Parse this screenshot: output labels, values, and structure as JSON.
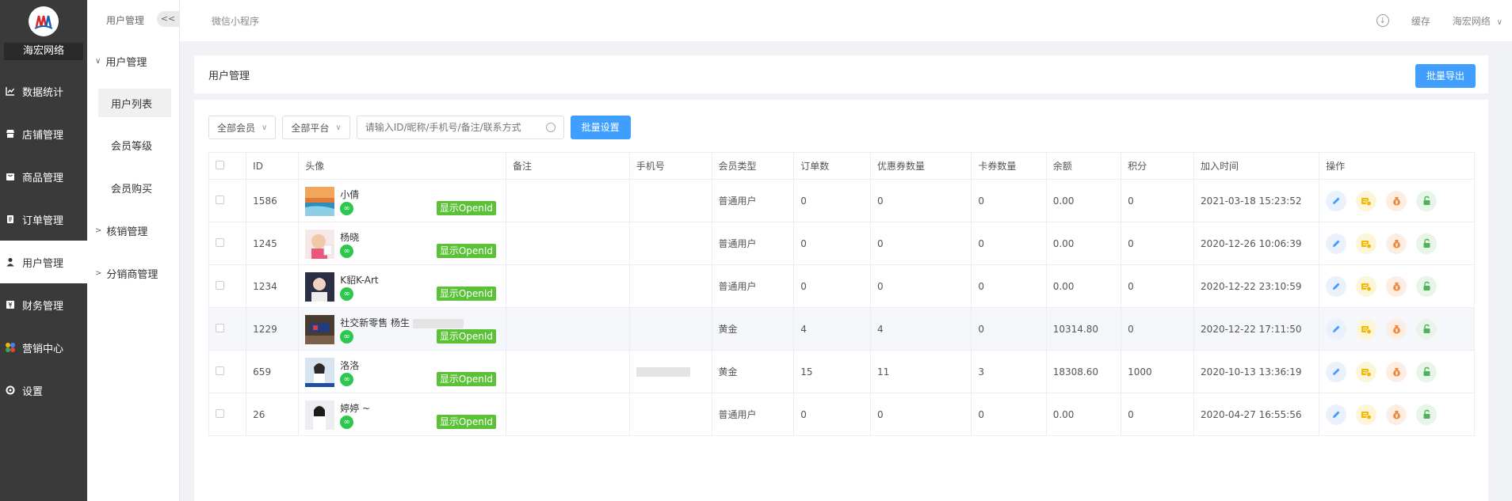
{
  "brand": {
    "name": "海宏网络"
  },
  "nav": [
    {
      "label": "数据统计",
      "icon": "chart-icon",
      "active": false
    },
    {
      "label": "店铺管理",
      "icon": "store-icon",
      "active": false
    },
    {
      "label": "商品管理",
      "icon": "product-icon",
      "active": false
    },
    {
      "label": "订单管理",
      "icon": "order-icon",
      "active": false
    },
    {
      "label": "用户管理",
      "icon": "user-icon",
      "active": true
    },
    {
      "label": "财务管理",
      "icon": "finance-icon",
      "active": false
    },
    {
      "label": "营销中心",
      "icon": "marketing-icon",
      "active": false
    },
    {
      "label": "设置",
      "icon": "settings-icon",
      "active": false
    }
  ],
  "subnav": {
    "header": "用户管理",
    "collapse": "<<",
    "group": "用户管理",
    "items": [
      "用户列表",
      "会员等级",
      "会员购买"
    ],
    "groups2": [
      "核销管理",
      "分销商管理"
    ]
  },
  "topbar": {
    "crumb": "微信小程序",
    "cache": "缓存",
    "user": "海宏网络"
  },
  "page": {
    "title": "用户管理",
    "export": "批量导出"
  },
  "filters": {
    "member": "全部会员",
    "platform": "全部平台",
    "search_placeholder": "请输入ID/昵称/手机号/备注/联系方式",
    "batch": "批量设置"
  },
  "table": {
    "headers": [
      "ID",
      "头像",
      "备注",
      "手机号",
      "会员类型",
      "订单数",
      "优惠券数量",
      "卡券数量",
      "余额",
      "积分",
      "加入时间",
      "操作"
    ],
    "openid_label": "显示OpenId",
    "rows": [
      {
        "id": "1586",
        "nick": "小倩",
        "note": "",
        "phone": "",
        "type": "普通用户",
        "orders": "0",
        "coupons": "0",
        "cards": "0",
        "balance": "0.00",
        "points": "0",
        "joined": "2021-03-18 15:23:52",
        "highlight": false,
        "avatar": "sea"
      },
      {
        "id": "1245",
        "nick": "杨晓",
        "note": "",
        "phone": "",
        "type": "普通用户",
        "orders": "0",
        "coupons": "0",
        "cards": "0",
        "balance": "0.00",
        "points": "0",
        "joined": "2020-12-26 10:06:39",
        "highlight": false,
        "avatar": "baby"
      },
      {
        "id": "1234",
        "nick": "K貂K-Art",
        "note": "",
        "phone": "",
        "type": "普通用户",
        "orders": "0",
        "coupons": "0",
        "cards": "0",
        "balance": "0.00",
        "points": "0",
        "joined": "2020-12-22 23:10:59",
        "highlight": false,
        "avatar": "portrait"
      },
      {
        "id": "1229",
        "nick": "社交新零售 杨生",
        "note": "",
        "phone": "",
        "type": "黄金",
        "orders": "4",
        "coupons": "4",
        "cards": "0",
        "balance": "10314.80",
        "points": "0",
        "joined": "2020-12-22 17:11:50",
        "highlight": true,
        "avatar": "office"
      },
      {
        "id": "659",
        "nick": "洛洛",
        "note": "",
        "phone": "",
        "type": "黄金",
        "orders": "15",
        "coupons": "11",
        "cards": "3",
        "balance": "18308.60",
        "points": "1000",
        "joined": "2020-10-13 13:36:19",
        "highlight": false,
        "avatar": "woman"
      },
      {
        "id": "26",
        "nick": "婷婷 ~",
        "note": "",
        "phone": "",
        "type": "普通用户",
        "orders": "0",
        "coupons": "0",
        "cards": "0",
        "balance": "0.00",
        "points": "0",
        "joined": "2020-04-27 16:55:56",
        "highlight": false,
        "avatar": "woman2"
      }
    ]
  },
  "colors": {
    "accent": "#409eff",
    "sidebar": "#3a3a3a",
    "openid": "#5bc238",
    "wechat": "#2cc84d"
  }
}
